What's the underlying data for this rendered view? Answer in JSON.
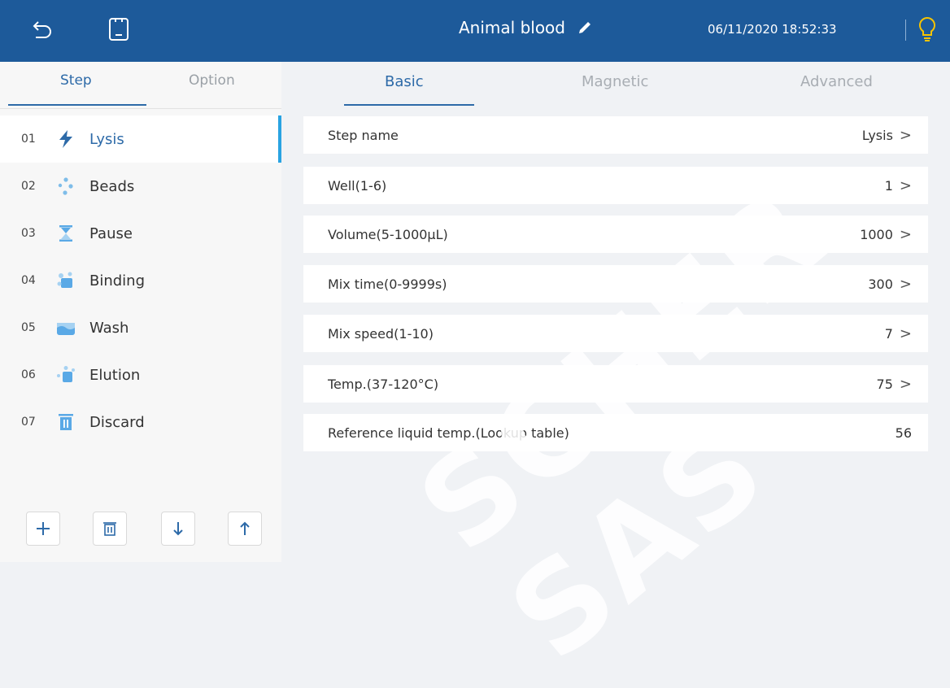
{
  "header": {
    "title": "Animal blood",
    "datetime": "06/11/2020 18:52:33",
    "icons": [
      "back-arrow-icon",
      "save-icon",
      "pencil-icon",
      "lightbulb-icon"
    ],
    "accent_color": "#1d5a9a"
  },
  "left_tabs": {
    "step": "Step",
    "option": "Option"
  },
  "steps": [
    {
      "num": "01",
      "label": "Lysis",
      "icon": "lightning-icon"
    },
    {
      "num": "02",
      "label": "Beads",
      "icon": "beads-icon"
    },
    {
      "num": "03",
      "label": "Pause",
      "icon": "hourglass-icon"
    },
    {
      "num": "04",
      "label": "Binding",
      "icon": "binding-icon"
    },
    {
      "num": "05",
      "label": "Wash",
      "icon": "wash-icon"
    },
    {
      "num": "06",
      "label": "Elution",
      "icon": "elution-icon"
    },
    {
      "num": "07",
      "label": "Discard",
      "icon": "trash-icon"
    }
  ],
  "bottom_buttons": [
    "add-icon",
    "delete-icon",
    "move-down-icon",
    "move-up-icon"
  ],
  "right_tabs": {
    "basic": "Basic",
    "magnetic": "Magnetic",
    "advanced": "Advanced"
  },
  "params": [
    {
      "label": "Step name",
      "value": "Lysis",
      "chevron": ">"
    },
    {
      "label": "Well(1-6)",
      "value": "1",
      "chevron": ">"
    },
    {
      "label": "Volume(5-1000μL)",
      "value": "1000",
      "chevron": ">"
    },
    {
      "label": "Mix time(0-9999s)",
      "value": "300",
      "chevron": ">"
    },
    {
      "label": "Mix speed(1-10)",
      "value": "7",
      "chevron": ">"
    },
    {
      "label": "Temp.(37-120°C)",
      "value": "75",
      "chevron": ">"
    },
    {
      "label": "Reference liquid temp.(Lookup table)",
      "value": "56"
    }
  ],
  "watermark": "SCHER SAS",
  "colors": {
    "active_tab": "#2d6aa8",
    "active_indicator": "#29a3e2",
    "icon_blue": "#5aa9e6"
  }
}
